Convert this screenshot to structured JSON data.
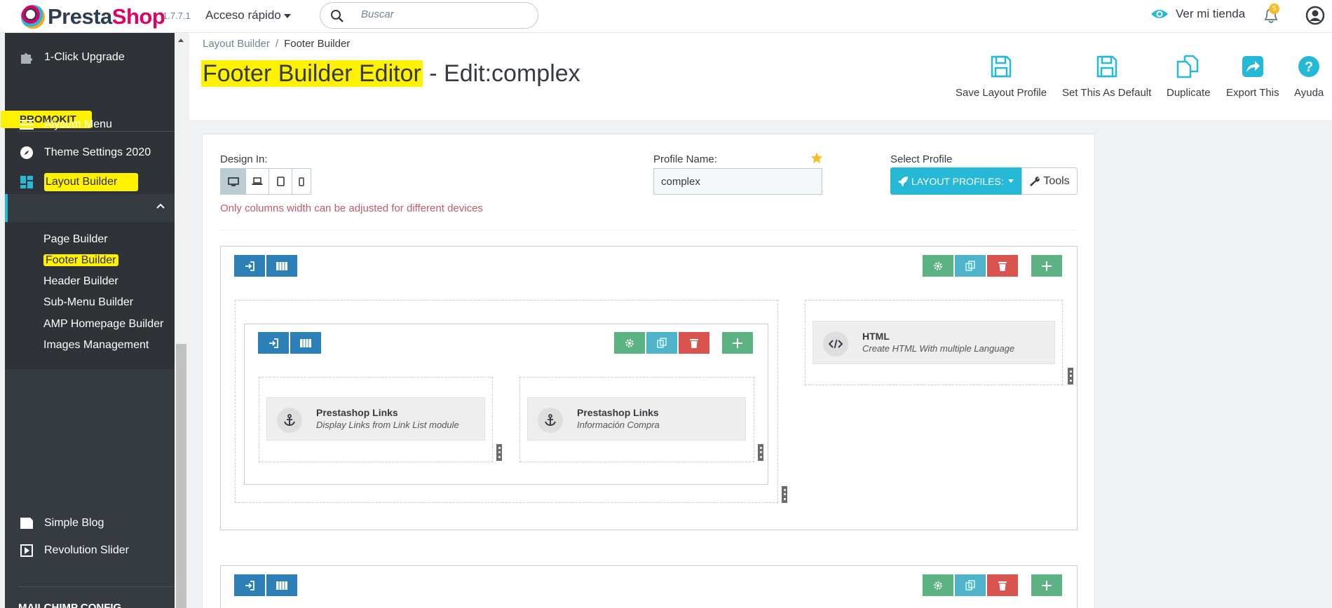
{
  "app": {
    "logo_part1": "Presta",
    "logo_part2": "Shop",
    "version": "1.7.7.1",
    "quick_access": "Acceso rápido",
    "search_placeholder": "Buscar",
    "view_shop": "Ver mi tienda",
    "notifications_count": "5"
  },
  "sidebar": {
    "upgrade": "1-Click Upgrade",
    "section": "PROMOKIT",
    "items": [
      {
        "label": "Alysum Menu",
        "icon": "hamburger-icon"
      },
      {
        "label": "Theme Settings 2020",
        "icon": "compass-icon"
      },
      {
        "label": "Layout Builder",
        "icon": "grid-icon"
      }
    ],
    "sub_items": [
      "Page Builder",
      "Footer Builder",
      "Header Builder",
      "Sub-Menu Builder",
      "AMP Homepage Builder",
      "Images Management"
    ],
    "bottom_items": [
      {
        "label": "Simple Blog",
        "icon": "blog-icon"
      },
      {
        "label": "Revolution Slider",
        "icon": "play-icon"
      }
    ],
    "cut_off": "MAILCHIMP CONFIG"
  },
  "header": {
    "breadcrumb_parent": "Layout Builder",
    "breadcrumb_sep": "/",
    "breadcrumb_current": "Footer Builder",
    "title_main": "Footer Builder Editor",
    "title_rest": " - Edit:complex",
    "toolbar": [
      "Save Layout Profile",
      "Set This As Default",
      "Duplicate",
      "Export This",
      "Ayuda"
    ]
  },
  "form": {
    "design_in_label": "Design In:",
    "warning": "Only columns width can be adjusted for different devices",
    "profile_name_label": "Profile Name:",
    "profile_name_value": "complex",
    "select_profile_label": "Select Profile",
    "layout_profiles_btn": "LAYOUT PROFILES:",
    "tools_btn": "Tools"
  },
  "widgets": [
    {
      "title": "Prestashop Links",
      "subtitle": "Display Links from Link List module"
    },
    {
      "title": "Prestashop Links",
      "subtitle": "Información Compra"
    },
    {
      "title": "HTML",
      "subtitle": "Create HTML With multiple Language"
    }
  ],
  "colors": {
    "accent": "#25b9d7",
    "blue_btn": "#2d7fb8",
    "green_btn": "#5cb283",
    "teal_btn": "#4fb3c9",
    "red_btn": "#d9534f",
    "highlight": "#fff200"
  }
}
